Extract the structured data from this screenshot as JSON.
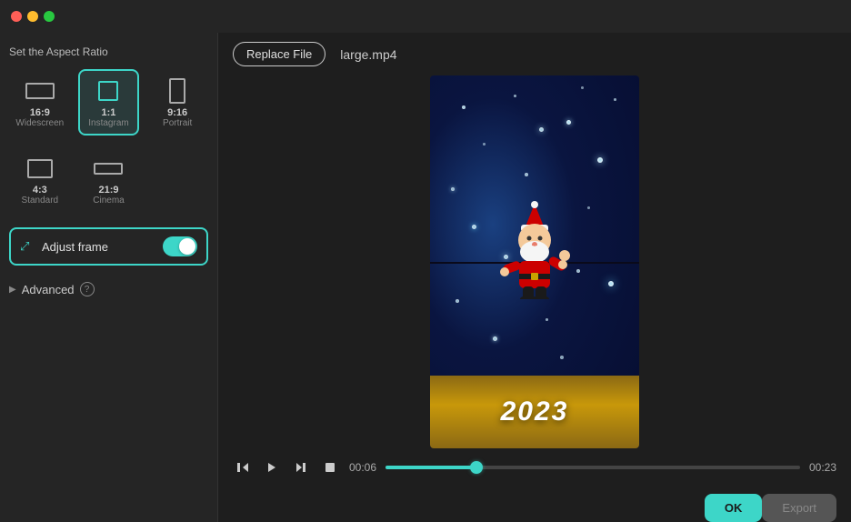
{
  "titleBar": {
    "trafficLights": [
      "red",
      "yellow",
      "green"
    ]
  },
  "leftPanel": {
    "sectionTitle": "Set the Aspect Ratio",
    "aspectRatios": [
      {
        "id": "16-9",
        "ratio": "16:9",
        "label": "Widescreen",
        "selected": false
      },
      {
        "id": "1-1",
        "ratio": "1:1",
        "label": "Instagram",
        "selected": true
      },
      {
        "id": "9-16",
        "ratio": "9:16",
        "label": "Portrait",
        "selected": false
      },
      {
        "id": "4-3",
        "ratio": "4:3",
        "label": "Standard",
        "selected": false
      },
      {
        "id": "21-9",
        "ratio": "21:9",
        "label": "Cinema",
        "selected": false
      }
    ],
    "adjustFrame": {
      "label": "Adjust frame",
      "enabled": true
    },
    "advanced": {
      "label": "Advanced",
      "helpTooltip": "?"
    }
  },
  "rightPanel": {
    "replaceFileBtn": "Replace File",
    "fileName": "large.mp4",
    "player": {
      "currentTime": "00:06",
      "totalTime": "00:23",
      "progress": 22
    },
    "okBtn": "OK",
    "exportBtn": "Export"
  }
}
